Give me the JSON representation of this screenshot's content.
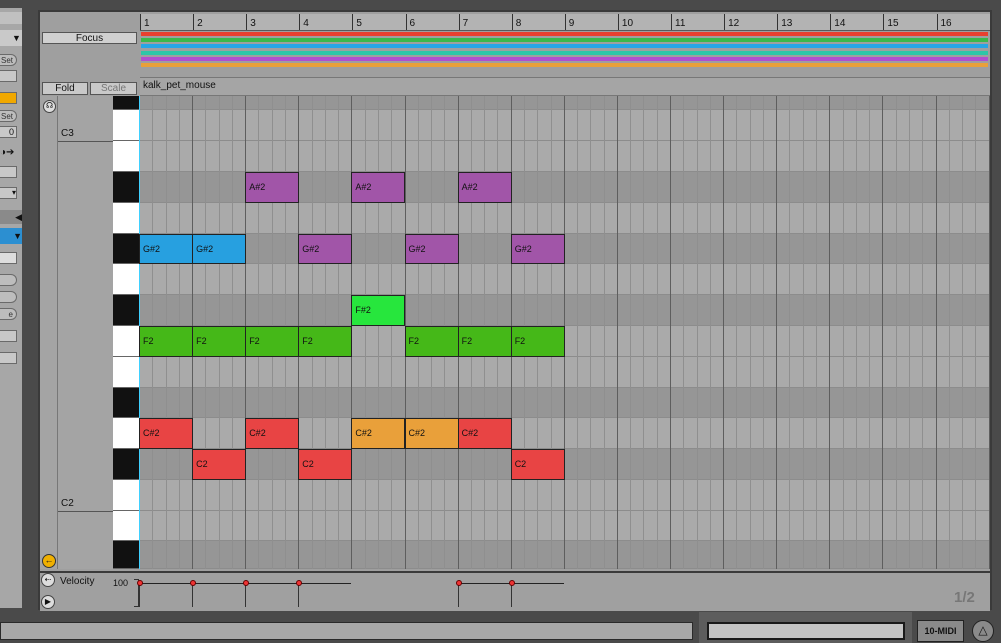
{
  "ruler": {
    "bars": [
      "1",
      "2",
      "3",
      "4",
      "5",
      "6",
      "7",
      "8",
      "9",
      "10",
      "11",
      "12",
      "13",
      "14",
      "15",
      "16"
    ]
  },
  "header": {
    "focus_label": "Focus",
    "fold_label": "Fold",
    "scale_label": "Scale",
    "clip_name": "kalk_pet_mouse"
  },
  "lane_colors": [
    "#e8402f",
    "#3bb84a",
    "#27a6e6",
    "#2ec6a8",
    "#b04fd0",
    "#e9a03a"
  ],
  "left_strip": {
    "set1": "Set",
    "set2": "Set",
    "value": "0",
    "e_label": "e"
  },
  "keyboard": {
    "c3_label": "C3",
    "c2_label": "C2"
  },
  "notes": [
    {
      "label": "A#2",
      "color": "#a155a8"
    },
    {
      "label": "A#2",
      "color": "#a155a8"
    },
    {
      "label": "A#2",
      "color": "#a155a8"
    },
    {
      "label": "G#2",
      "color": "#27a0e0"
    },
    {
      "label": "G#2",
      "color": "#27a0e0"
    },
    {
      "label": "G#2",
      "color": "#a155a8"
    },
    {
      "label": "G#2",
      "color": "#a155a8"
    },
    {
      "label": "G#2",
      "color": "#a155a8"
    },
    {
      "label": "F#2",
      "color": "#27e63d"
    },
    {
      "label": "F2",
      "color": "#45b818"
    },
    {
      "label": "F2",
      "color": "#45b818"
    },
    {
      "label": "F2",
      "color": "#45b818"
    },
    {
      "label": "F2",
      "color": "#45b818"
    },
    {
      "label": "F2",
      "color": "#45b818"
    },
    {
      "label": "F2",
      "color": "#45b818"
    },
    {
      "label": "F2",
      "color": "#45b818"
    },
    {
      "label": "C#2",
      "color": "#e84444"
    },
    {
      "label": "C#2",
      "color": "#e84444"
    },
    {
      "label": "C#2",
      "color": "#e9a03a"
    },
    {
      "label": "C#2",
      "color": "#e9a03a"
    },
    {
      "label": "C#2",
      "color": "#e84444"
    },
    {
      "label": "C2",
      "color": "#e84444"
    },
    {
      "label": "C2",
      "color": "#e84444"
    },
    {
      "label": "C2",
      "color": "#e84444"
    }
  ],
  "velocity": {
    "label": "Velocity",
    "value_label": "100",
    "page_indicator": "1/2"
  },
  "bottom": {
    "track_label": "10-MIDI"
  }
}
